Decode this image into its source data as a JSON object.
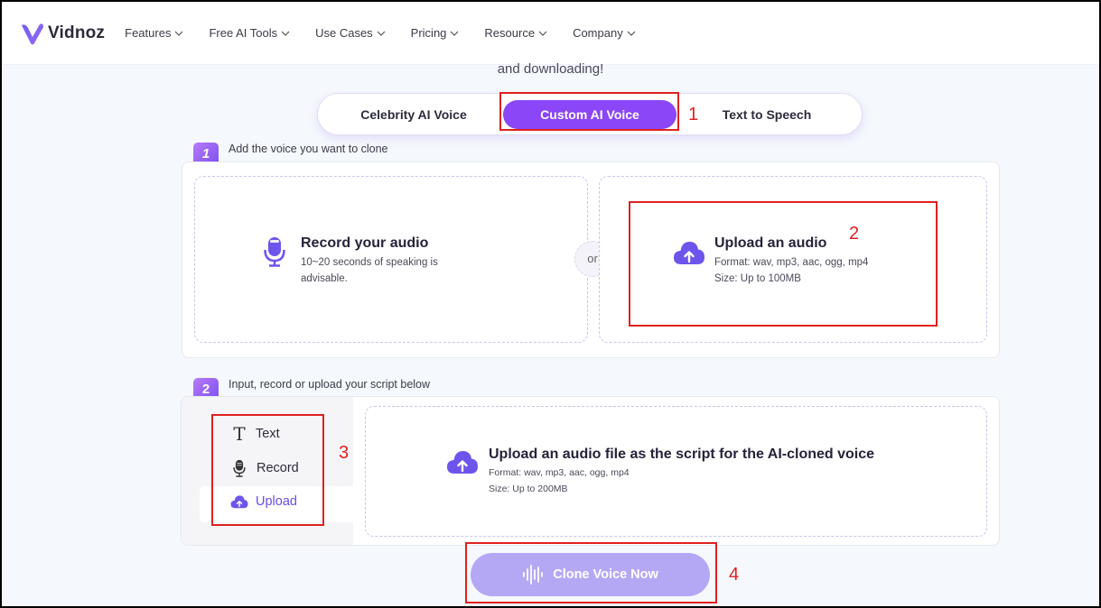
{
  "brand": {
    "name": "Vidnoz",
    "accent": "#8b46f7",
    "accent_light": "#b4a8f5",
    "icon": "vidnoz-logo-icon"
  },
  "nav": {
    "items": [
      {
        "label": "Features",
        "icon": "chevron-down-icon"
      },
      {
        "label": "Free AI Tools",
        "icon": "chevron-down-icon"
      },
      {
        "label": "Use Cases",
        "icon": "chevron-down-icon"
      },
      {
        "label": "Pricing",
        "icon": "chevron-down-icon"
      },
      {
        "label": "Resource",
        "icon": "chevron-down-icon"
      },
      {
        "label": "Company",
        "icon": "chevron-down-icon"
      }
    ]
  },
  "hero": {
    "subtitle_partial": "and downloading!"
  },
  "tabs": {
    "items": [
      {
        "label": "Celebrity AI Voice",
        "active": false
      },
      {
        "label": "Custom AI Voice",
        "active": true
      },
      {
        "label": "Text to Speech",
        "active": false
      }
    ]
  },
  "annotations": {
    "a1": "1",
    "a2": "2",
    "a3": "3",
    "a4": "4",
    "color": "#e02020"
  },
  "step1": {
    "number": "1",
    "label": "Add the voice you want to clone",
    "record": {
      "title": "Record your audio",
      "desc": "10~20 seconds of speaking is advisable.",
      "icon": "microphone-icon"
    },
    "or_label": "or",
    "upload": {
      "title": "Upload an audio",
      "format": "Format: wav, mp3, aac, ogg, mp4",
      "size": "Size: Up to 100MB",
      "icon": "cloud-upload-icon"
    }
  },
  "step2": {
    "number": "2",
    "label": "Input, record or upload your script below",
    "side_items": [
      {
        "label": "Text",
        "icon": "text-icon",
        "active": false
      },
      {
        "label": "Record",
        "icon": "microphone-icon",
        "active": false
      },
      {
        "label": "Upload",
        "icon": "cloud-upload-icon",
        "active": true
      }
    ],
    "upload": {
      "title": "Upload an audio file as the script for the AI-cloned voice",
      "format": "Format: wav, mp3, aac, ogg, mp4",
      "size": "Size: Up to 200MB",
      "icon": "cloud-upload-icon"
    }
  },
  "clone_button": {
    "label": "Clone Voice Now",
    "icon": "waveform-icon"
  }
}
